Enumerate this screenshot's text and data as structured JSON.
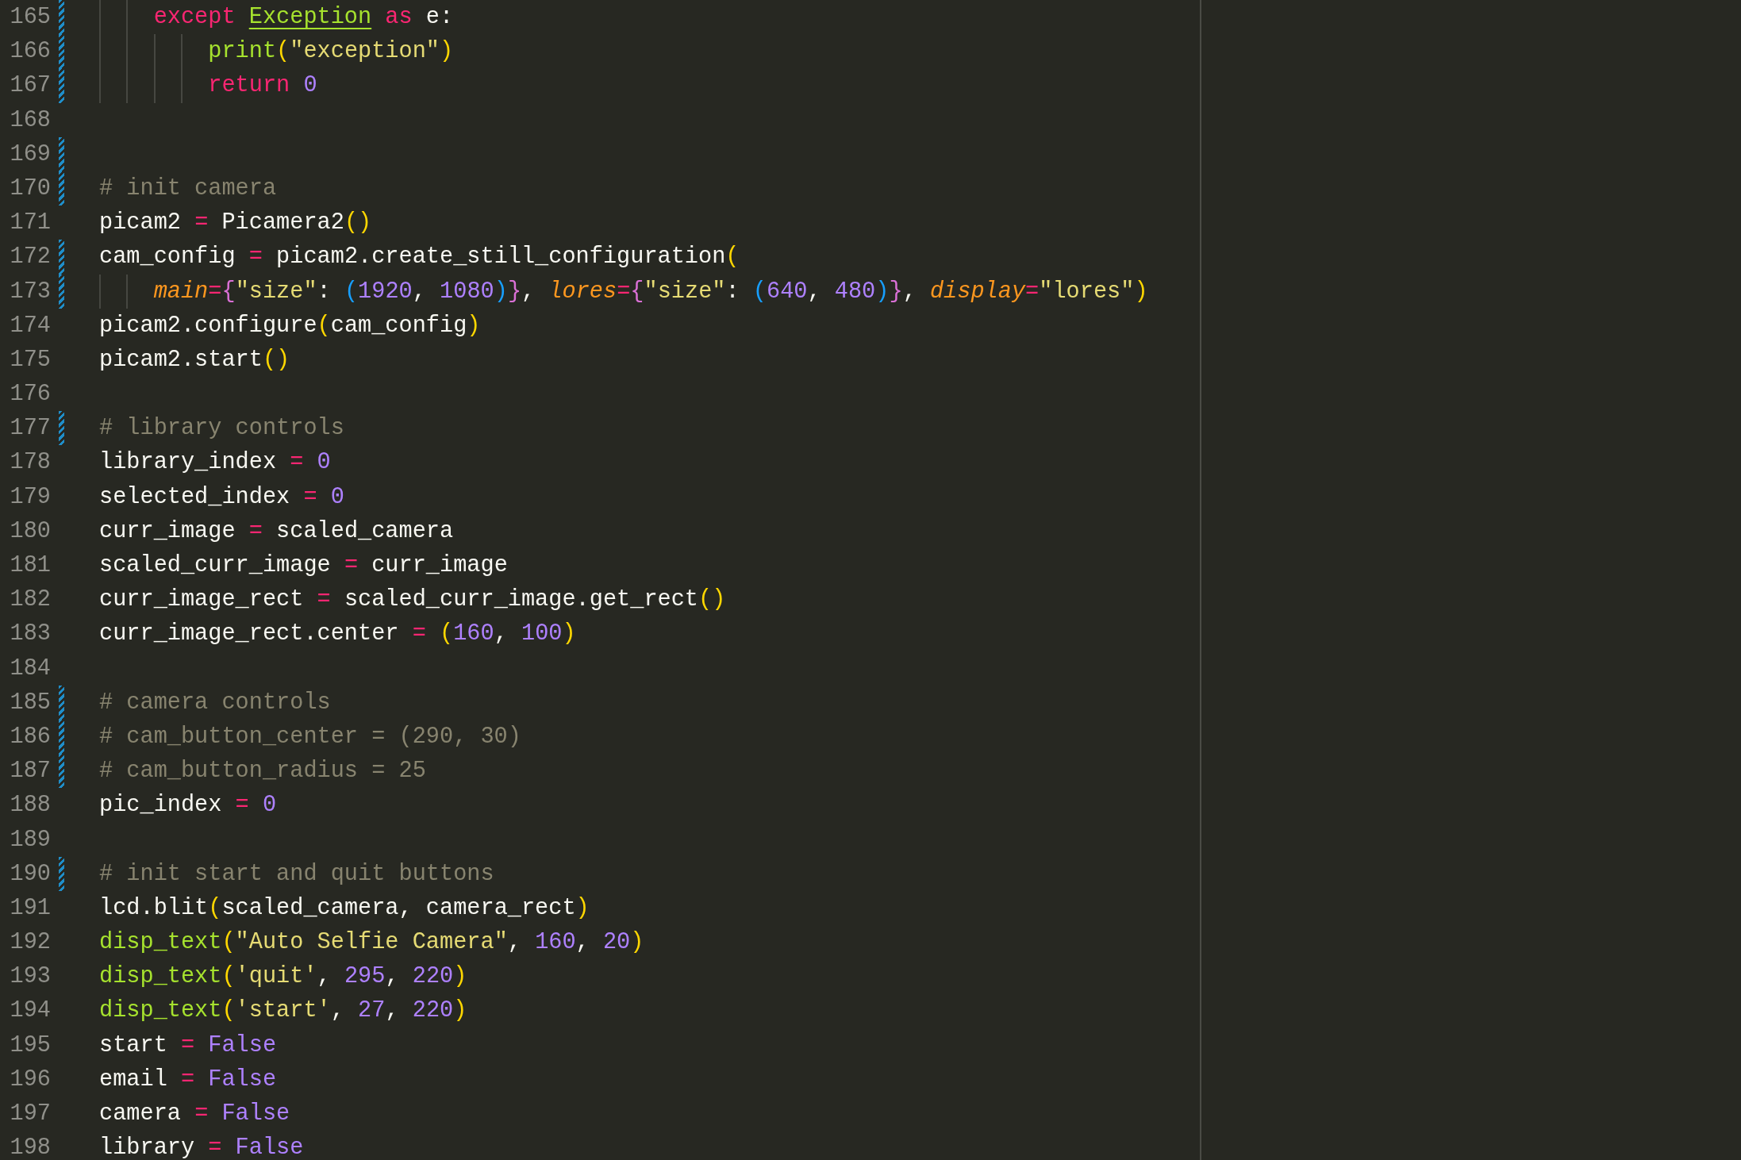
{
  "editor": {
    "lines": [
      {
        "number": "165",
        "modified": true,
        "tokens": [
          {
            "kind": "kw",
            "text": "    except "
          },
          {
            "kind": "cls",
            "text": "Exception"
          },
          {
            "kind": "kw",
            "text": " as"
          },
          {
            "kind": "txt",
            "text": " e:"
          }
        ]
      },
      {
        "number": "166",
        "modified": true,
        "tokens": [
          {
            "kind": "fn",
            "text": "        print"
          },
          {
            "kind": "b1",
            "text": "("
          },
          {
            "kind": "str",
            "text": "\"exception\""
          },
          {
            "kind": "b1",
            "text": ")"
          }
        ]
      },
      {
        "number": "167",
        "modified": true,
        "tokens": [
          {
            "kind": "kw",
            "text": "        return "
          },
          {
            "kind": "num",
            "text": "0"
          }
        ]
      },
      {
        "number": "168",
        "modified": false
      },
      {
        "number": "169",
        "modified": true
      },
      {
        "number": "170",
        "modified": true,
        "tokens": [
          {
            "kind": "com",
            "text": "# init camera"
          }
        ]
      },
      {
        "number": "171",
        "modified": false,
        "tokens": [
          {
            "kind": "txt",
            "text": "picam2 "
          },
          {
            "kind": "kw",
            "text": "="
          },
          {
            "kind": "txt",
            "text": " Picamera2"
          },
          {
            "kind": "b1",
            "text": "()"
          }
        ]
      },
      {
        "number": "172",
        "modified": true,
        "tokens": [
          {
            "kind": "txt",
            "text": "cam_config "
          },
          {
            "kind": "kw",
            "text": "="
          },
          {
            "kind": "txt",
            "text": " picam2.create_still_configuration"
          },
          {
            "kind": "b1",
            "text": "("
          }
        ]
      },
      {
        "number": "173",
        "modified": true,
        "tokens": [
          {
            "kind": "par",
            "text": "    main"
          },
          {
            "kind": "kw",
            "text": "="
          },
          {
            "kind": "b2",
            "text": "{"
          },
          {
            "kind": "str",
            "text": "\"size\""
          },
          {
            "kind": "txt",
            "text": ": "
          },
          {
            "kind": "b3",
            "text": "("
          },
          {
            "kind": "num",
            "text": "1920"
          },
          {
            "kind": "txt",
            "text": ", "
          },
          {
            "kind": "num",
            "text": "1080"
          },
          {
            "kind": "b3",
            "text": ")"
          },
          {
            "kind": "b2",
            "text": "}"
          },
          {
            "kind": "txt",
            "text": ", "
          },
          {
            "kind": "par",
            "text": "lores"
          },
          {
            "kind": "kw",
            "text": "="
          },
          {
            "kind": "b2",
            "text": "{"
          },
          {
            "kind": "str",
            "text": "\"size\""
          },
          {
            "kind": "txt",
            "text": ": "
          },
          {
            "kind": "b3",
            "text": "("
          },
          {
            "kind": "num",
            "text": "640"
          },
          {
            "kind": "txt",
            "text": ", "
          },
          {
            "kind": "num",
            "text": "480"
          },
          {
            "kind": "b3",
            "text": ")"
          },
          {
            "kind": "b2",
            "text": "}"
          },
          {
            "kind": "txt",
            "text": ", "
          },
          {
            "kind": "par",
            "text": "display"
          },
          {
            "kind": "kw",
            "text": "="
          },
          {
            "kind": "str",
            "text": "\"lores\""
          },
          {
            "kind": "b1",
            "text": ")"
          }
        ]
      },
      {
        "number": "174",
        "modified": false,
        "tokens": [
          {
            "kind": "txt",
            "text": "picam2.configure"
          },
          {
            "kind": "b1",
            "text": "("
          },
          {
            "kind": "txt",
            "text": "cam_config"
          },
          {
            "kind": "b1",
            "text": ")"
          }
        ]
      },
      {
        "number": "175",
        "modified": false,
        "tokens": [
          {
            "kind": "txt",
            "text": "picam2.start"
          },
          {
            "kind": "b1",
            "text": "()"
          }
        ]
      },
      {
        "number": "176",
        "modified": false
      },
      {
        "number": "177",
        "modified": true,
        "tokens": [
          {
            "kind": "com",
            "text": "# library controls"
          }
        ]
      },
      {
        "number": "178",
        "modified": false,
        "tokens": [
          {
            "kind": "txt",
            "text": "library_index "
          },
          {
            "kind": "kw",
            "text": "="
          },
          {
            "kind": "num",
            "text": " 0"
          }
        ]
      },
      {
        "number": "179",
        "modified": false,
        "tokens": [
          {
            "kind": "txt",
            "text": "selected_index "
          },
          {
            "kind": "kw",
            "text": "="
          },
          {
            "kind": "num",
            "text": " 0"
          }
        ]
      },
      {
        "number": "180",
        "modified": false,
        "tokens": [
          {
            "kind": "txt",
            "text": "curr_image "
          },
          {
            "kind": "kw",
            "text": "="
          },
          {
            "kind": "txt",
            "text": " scaled_camera"
          }
        ]
      },
      {
        "number": "181",
        "modified": false,
        "tokens": [
          {
            "kind": "txt",
            "text": "scaled_curr_image "
          },
          {
            "kind": "kw",
            "text": "="
          },
          {
            "kind": "txt",
            "text": " curr_image"
          }
        ]
      },
      {
        "number": "182",
        "modified": false,
        "tokens": [
          {
            "kind": "txt",
            "text": "curr_image_rect "
          },
          {
            "kind": "kw",
            "text": "="
          },
          {
            "kind": "txt",
            "text": " scaled_curr_image.get_rect"
          },
          {
            "kind": "b1",
            "text": "()"
          }
        ]
      },
      {
        "number": "183",
        "modified": false,
        "tokens": [
          {
            "kind": "txt",
            "text": "curr_image_rect.center "
          },
          {
            "kind": "kw",
            "text": "="
          },
          {
            "kind": "b1",
            "text": " ("
          },
          {
            "kind": "num",
            "text": "160"
          },
          {
            "kind": "txt",
            "text": ", "
          },
          {
            "kind": "num",
            "text": "100"
          },
          {
            "kind": "b1",
            "text": ")"
          }
        ]
      },
      {
        "number": "184",
        "modified": false
      },
      {
        "number": "185",
        "modified": true,
        "tokens": [
          {
            "kind": "com",
            "text": "# camera controls"
          }
        ]
      },
      {
        "number": "186",
        "modified": true,
        "tokens": [
          {
            "kind": "com",
            "text": "# cam_button_center = (290, 30)"
          }
        ]
      },
      {
        "number": "187",
        "modified": true,
        "tokens": [
          {
            "kind": "com",
            "text": "# cam_button_radius = 25"
          }
        ]
      },
      {
        "number": "188",
        "modified": false,
        "tokens": [
          {
            "kind": "txt",
            "text": "pic_index "
          },
          {
            "kind": "kw",
            "text": "="
          },
          {
            "kind": "num",
            "text": " 0"
          }
        ]
      },
      {
        "number": "189",
        "modified": false
      },
      {
        "number": "190",
        "modified": true,
        "tokens": [
          {
            "kind": "com",
            "text": "# init start and quit buttons"
          }
        ]
      },
      {
        "number": "191",
        "modified": false,
        "tokens": [
          {
            "kind": "txt",
            "text": "lcd.blit"
          },
          {
            "kind": "b1",
            "text": "("
          },
          {
            "kind": "txt",
            "text": "scaled_camera, camera_rect"
          },
          {
            "kind": "b1",
            "text": ")"
          }
        ]
      },
      {
        "number": "192",
        "modified": false,
        "tokens": [
          {
            "kind": "fn",
            "text": "disp_text"
          },
          {
            "kind": "b1",
            "text": "("
          },
          {
            "kind": "str",
            "text": "\"Auto Selfie Camera\""
          },
          {
            "kind": "txt",
            "text": ", "
          },
          {
            "kind": "num",
            "text": "160"
          },
          {
            "kind": "txt",
            "text": ", "
          },
          {
            "kind": "num",
            "text": "20"
          },
          {
            "kind": "b1",
            "text": ")"
          }
        ]
      },
      {
        "number": "193",
        "modified": false,
        "tokens": [
          {
            "kind": "fn",
            "text": "disp_text"
          },
          {
            "kind": "b1",
            "text": "("
          },
          {
            "kind": "str",
            "text": "'quit'"
          },
          {
            "kind": "txt",
            "text": ", "
          },
          {
            "kind": "num",
            "text": "295"
          },
          {
            "kind": "txt",
            "text": ", "
          },
          {
            "kind": "num",
            "text": "220"
          },
          {
            "kind": "b1",
            "text": ")"
          }
        ]
      },
      {
        "number": "194",
        "modified": false,
        "tokens": [
          {
            "kind": "fn",
            "text": "disp_text"
          },
          {
            "kind": "b1",
            "text": "("
          },
          {
            "kind": "str",
            "text": "'start'"
          },
          {
            "kind": "txt",
            "text": ", "
          },
          {
            "kind": "num",
            "text": "27"
          },
          {
            "kind": "txt",
            "text": ", "
          },
          {
            "kind": "num",
            "text": "220"
          },
          {
            "kind": "b1",
            "text": ")"
          }
        ]
      },
      {
        "number": "195",
        "modified": false,
        "tokens": [
          {
            "kind": "txt",
            "text": "start "
          },
          {
            "kind": "kw",
            "text": "="
          },
          {
            "kind": "num",
            "text": " False"
          }
        ]
      },
      {
        "number": "196",
        "modified": false,
        "tokens": [
          {
            "kind": "txt",
            "text": "email "
          },
          {
            "kind": "kw",
            "text": "="
          },
          {
            "kind": "num",
            "text": " False"
          }
        ]
      },
      {
        "number": "197",
        "modified": false,
        "tokens": [
          {
            "kind": "txt",
            "text": "camera "
          },
          {
            "kind": "kw",
            "text": "="
          },
          {
            "kind": "num",
            "text": " False"
          }
        ]
      },
      {
        "number": "198",
        "modified": false,
        "tokens": [
          {
            "kind": "txt",
            "text": "library "
          },
          {
            "kind": "kw",
            "text": "="
          },
          {
            "kind": "num",
            "text": " False"
          }
        ]
      }
    ]
  }
}
